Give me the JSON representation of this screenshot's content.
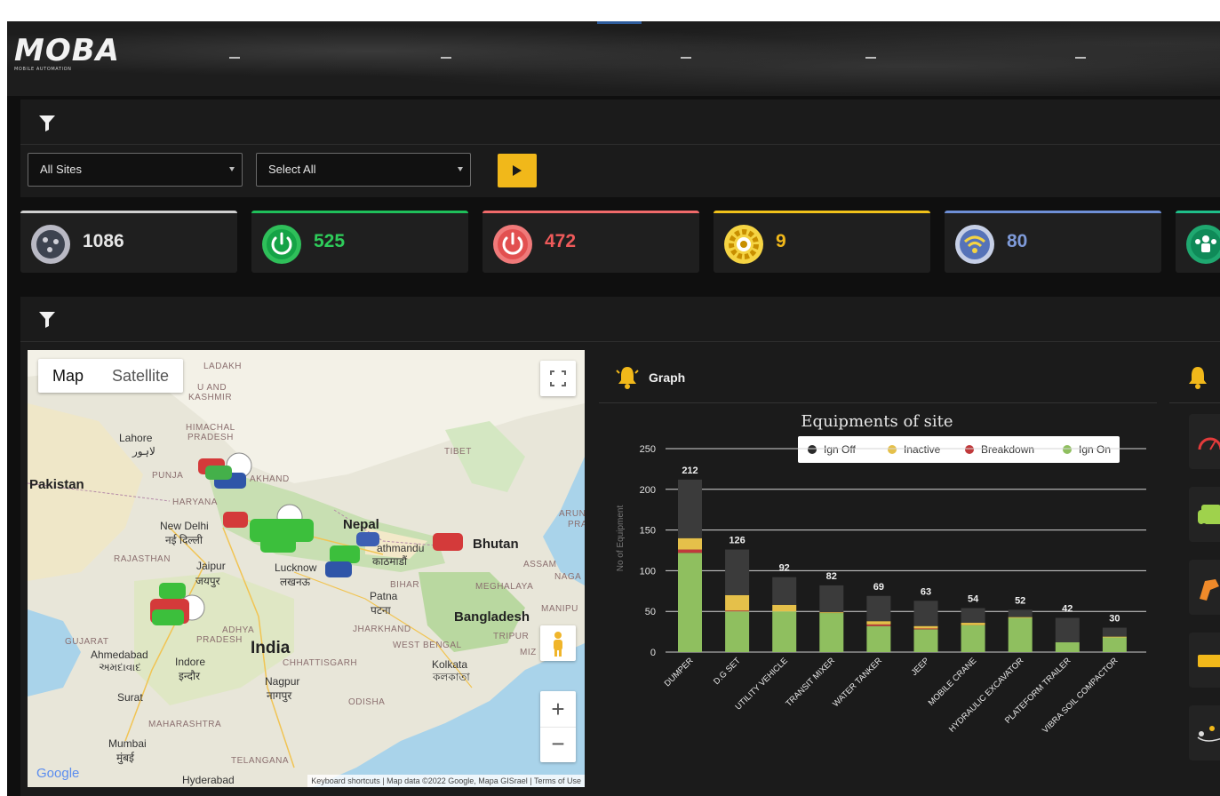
{
  "header": {
    "logo_text": "MOBA",
    "logo_subtitle": "MOBILE AUTOMATION"
  },
  "filters": {
    "site_select": "All Sites",
    "type_select": "Select All"
  },
  "stats": [
    {
      "value": "1086",
      "color": "#e6e6e6",
      "icon": "equipment-icon"
    },
    {
      "value": "525",
      "color": "#2ecc5a",
      "icon": "power-on-icon"
    },
    {
      "value": "472",
      "color": "#ef5a5a",
      "icon": "power-off-icon"
    },
    {
      "value": "9",
      "color": "#f1b81a",
      "icon": "breakdown-gear-icon"
    },
    {
      "value": "80",
      "color": "#7e9ad8",
      "icon": "wifi-icon"
    }
  ],
  "map": {
    "type_map": "Map",
    "type_satellite": "Satellite",
    "labels": {
      "pakistan": "Pakistan",
      "lahore": "Lahore",
      "lahore_local": "لاہور",
      "himachal": "HIMACHAL",
      "pradesh": "PRADESH",
      "ladakh": "LADAKH",
      "jk1": "U AND",
      "jk2": "KASHMIR",
      "punjab": "PUNJA",
      "khand": "AKHAND",
      "haryana": "HARYANA",
      "tibet": "TIBET",
      "newdelhi": "New Delhi",
      "newdelhi_local": "नई दिल्ली",
      "rajasthan": "RAJASTHAN",
      "jaipur": "Jaipur",
      "jaipur_local": "जयपुर",
      "lucknow": "Lucknow",
      "lucknow_local": "लखनऊ",
      "nepal": "Nepal",
      "kathmandu": "athmandu",
      "kathmandu_local": "काठमाडौं",
      "bhutan": "Bhutan",
      "assam": "ASSAM",
      "naga": "NAGA",
      "meghalaya": "MEGHALAYA",
      "manipur": "MANIPU",
      "bihar": "BIHAR",
      "patna": "Patna",
      "patna_local": "पटना",
      "bangladesh": "Bangladesh",
      "tripura": "TRIPUR",
      "jharkhand": "JHARKHAND",
      "westbengal": "WEST BENGAL",
      "kolkata": "Kolkata",
      "kolkata_local": "কলকাতা",
      "madhya": "ADHYA",
      "madhya2": "PRADESH",
      "gujarat": "GUJARAT",
      "ahmedabad": "Ahmedabad",
      "ahmedabad_local": "અમદાવાદ",
      "indore": "Indore",
      "indore_local": "इन्दौर",
      "india": "India",
      "chhattisgarh": "CHHATTISGARH",
      "nagpur": "Nagpur",
      "nagpur_local": "नागपुर",
      "odisha": "ODISHA",
      "surat": "Surat",
      "maharashtra": "MAHARASHTRA",
      "mumbai": "Mumbai",
      "mumbai_local": "मुंबई",
      "telangana": "TELANGANA",
      "hyderabad": "Hyderabad",
      "arun": "ARUN",
      "pra": "PRA",
      "miz": "MIZ"
    },
    "google": "Google",
    "attribution": "Keyboard shortcuts  |  Map data ©2022 Google, Mapa GISrael  |  Terms of Use",
    "zoom_in": "+",
    "zoom_out": "−"
  },
  "graph": {
    "title": "Graph"
  },
  "chart_data": {
    "type": "bar",
    "stacked": true,
    "title": "Equipments of site",
    "ylabel": "No of Equipment",
    "ylim": [
      0,
      250
    ],
    "yticks": [
      0,
      50,
      100,
      150,
      200,
      250
    ],
    "legend_position": "top-right",
    "categories": [
      "DUMPER",
      "D.G SET",
      "UTILITY VEHICLE",
      "TRANSIT MIXER",
      "WATER TANKER",
      "JEEP",
      "MOBILE CRANE",
      "HYDRAULIC EXCAVATOR",
      "PLATEFORM TRAILER",
      "VIBRA SOIL COMPACTOR"
    ],
    "totals": [
      212,
      126,
      92,
      82,
      69,
      63,
      54,
      52,
      42,
      30
    ],
    "series": [
      {
        "name": "Ign On",
        "color": "#8fbf5f",
        "values": [
          122,
          50,
          50,
          48,
          32,
          28,
          33,
          42,
          12,
          18
        ]
      },
      {
        "name": "Breakdown",
        "color": "#c0393b",
        "values": [
          4,
          1,
          0,
          0,
          2,
          1,
          0,
          0,
          0,
          0
        ]
      },
      {
        "name": "Inactive",
        "color": "#e5c04a",
        "values": [
          14,
          19,
          8,
          1,
          4,
          3,
          3,
          1,
          0,
          1
        ]
      },
      {
        "name": "Ign Off",
        "color": "#3b3b3b",
        "values": [
          72,
          56,
          34,
          33,
          31,
          31,
          18,
          9,
          30,
          11
        ]
      }
    ],
    "legend": [
      "Ign Off",
      "Inactive",
      "Breakdown",
      "Ign On"
    ],
    "legend_colors": [
      "#2a2a2a",
      "#e5c04a",
      "#c0393b",
      "#8fbf5f"
    ]
  }
}
